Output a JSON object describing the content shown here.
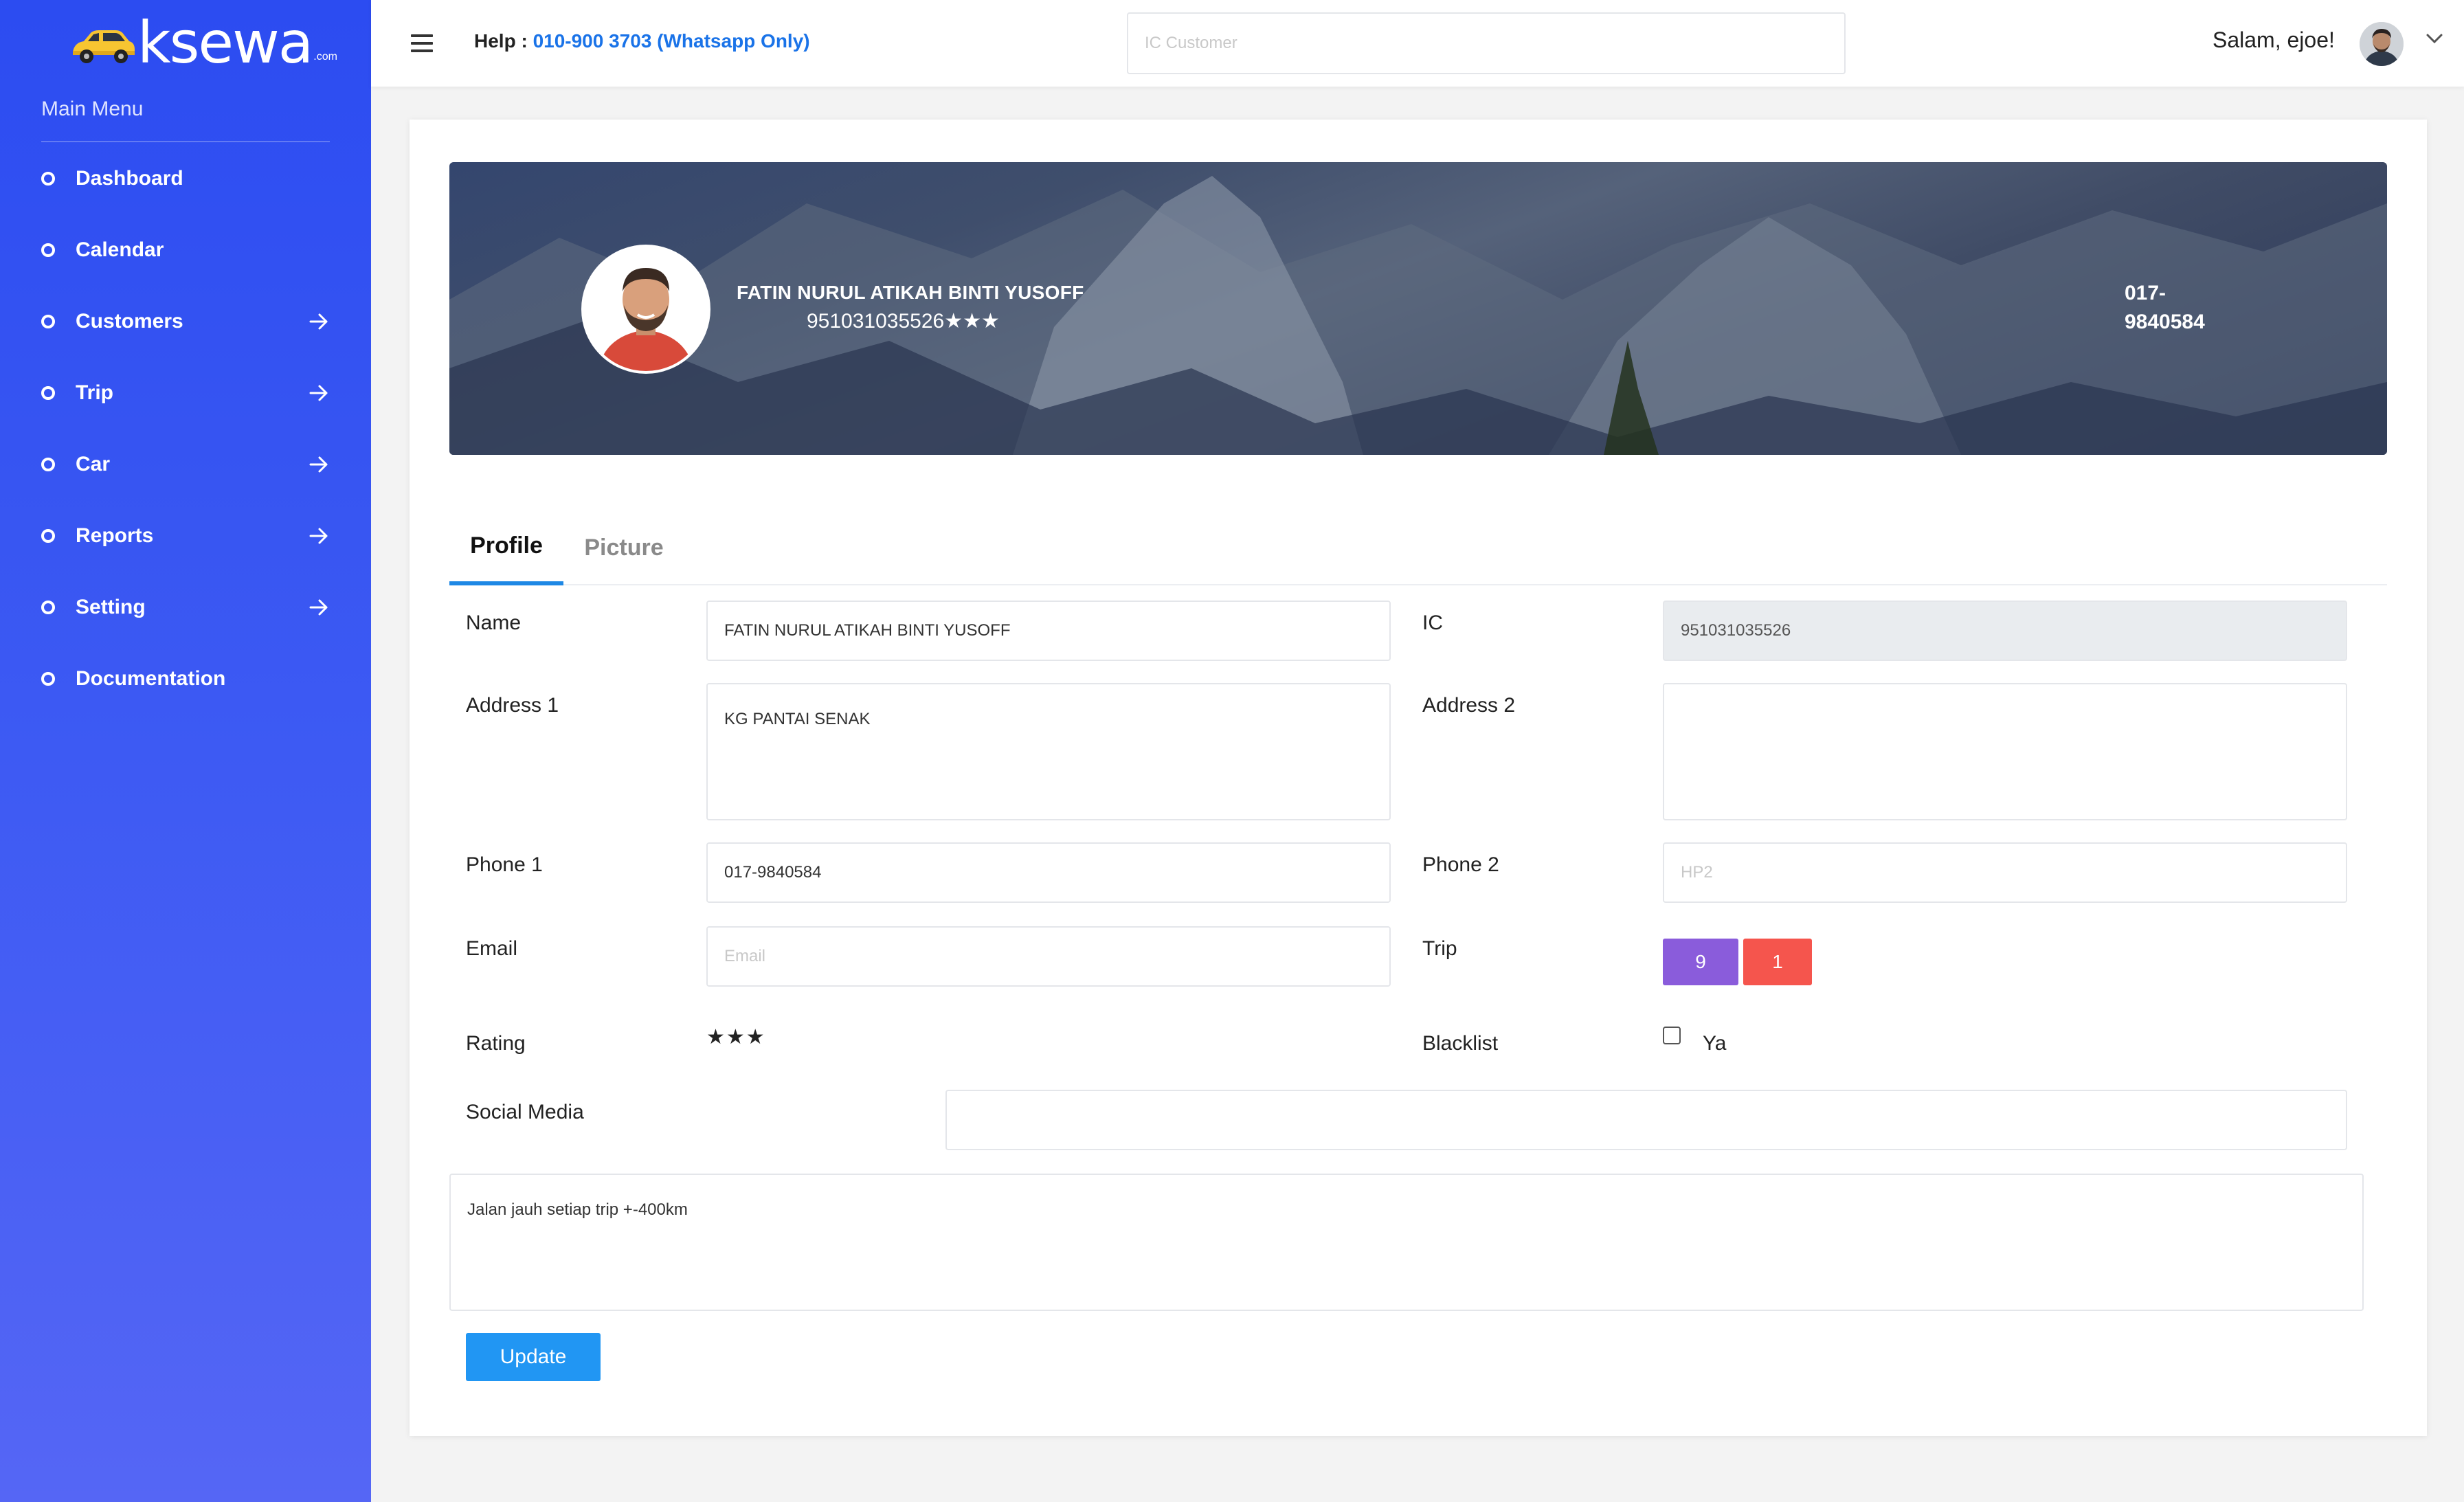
{
  "brand": {
    "logo_text": "ksewa",
    "logo_suffix": ".com"
  },
  "sidebar": {
    "section_title": "Main Menu",
    "items": [
      {
        "label": "Dashboard",
        "has_arrow": false
      },
      {
        "label": "Calendar",
        "has_arrow": false
      },
      {
        "label": "Customers",
        "has_arrow": true
      },
      {
        "label": "Trip",
        "has_arrow": true
      },
      {
        "label": "Car",
        "has_arrow": true
      },
      {
        "label": "Reports",
        "has_arrow": true
      },
      {
        "label": "Setting",
        "has_arrow": true
      },
      {
        "label": "Documentation",
        "has_arrow": false
      }
    ]
  },
  "topbar": {
    "help_label": "Help : ",
    "help_phone": "010-900 3703 (Whatsapp Only)",
    "search_placeholder": "IC Customer",
    "greeting": "Salam, ejoe!"
  },
  "profile_banner": {
    "name": "FATIN NURUL ATIKAH BINTI YUSOFF",
    "ic_with_rating": "951031035526★★★",
    "phone": "017-9840584"
  },
  "tabs": [
    {
      "label": "Profile",
      "active": true
    },
    {
      "label": "Picture",
      "active": false
    }
  ],
  "form": {
    "name_label": "Name",
    "name_value": "FATIN NURUL ATIKAH BINTI YUSOFF",
    "ic_label": "IC",
    "ic_value": "951031035526",
    "address1_label": "Address 1",
    "address1_value": "KG PANTAI SENAK",
    "address2_label": "Address 2",
    "address2_value": "",
    "phone1_label": "Phone 1",
    "phone1_value": "017-9840584",
    "phone2_label": "Phone 2",
    "phone2_placeholder": "HP2",
    "email_label": "Email",
    "email_placeholder": "Email",
    "trip_label": "Trip",
    "trip_count_primary": "9",
    "trip_count_secondary": "1",
    "rating_label": "Rating",
    "rating_stars": "★★★",
    "blacklist_label": "Blacklist",
    "blacklist_checked": false,
    "blacklist_option": "Ya",
    "social_label": "Social Media",
    "social_value": "",
    "notes_value": "Jalan jauh setiap trip +-400km",
    "update_label": "Update"
  },
  "colors": {
    "sidebar_top": "#2c4cf1",
    "sidebar_bottom": "#5566f5",
    "accent_blue": "#2196f3",
    "link_blue": "#1a73e8",
    "trip_purple": "#8a5cdb",
    "trip_red": "#f5554d"
  },
  "icons": {
    "menu": "hamburger-icon",
    "arrow": "arrow-right-icon",
    "bullet": "circle-bullet-icon",
    "dropdown": "chevron-down-icon"
  }
}
